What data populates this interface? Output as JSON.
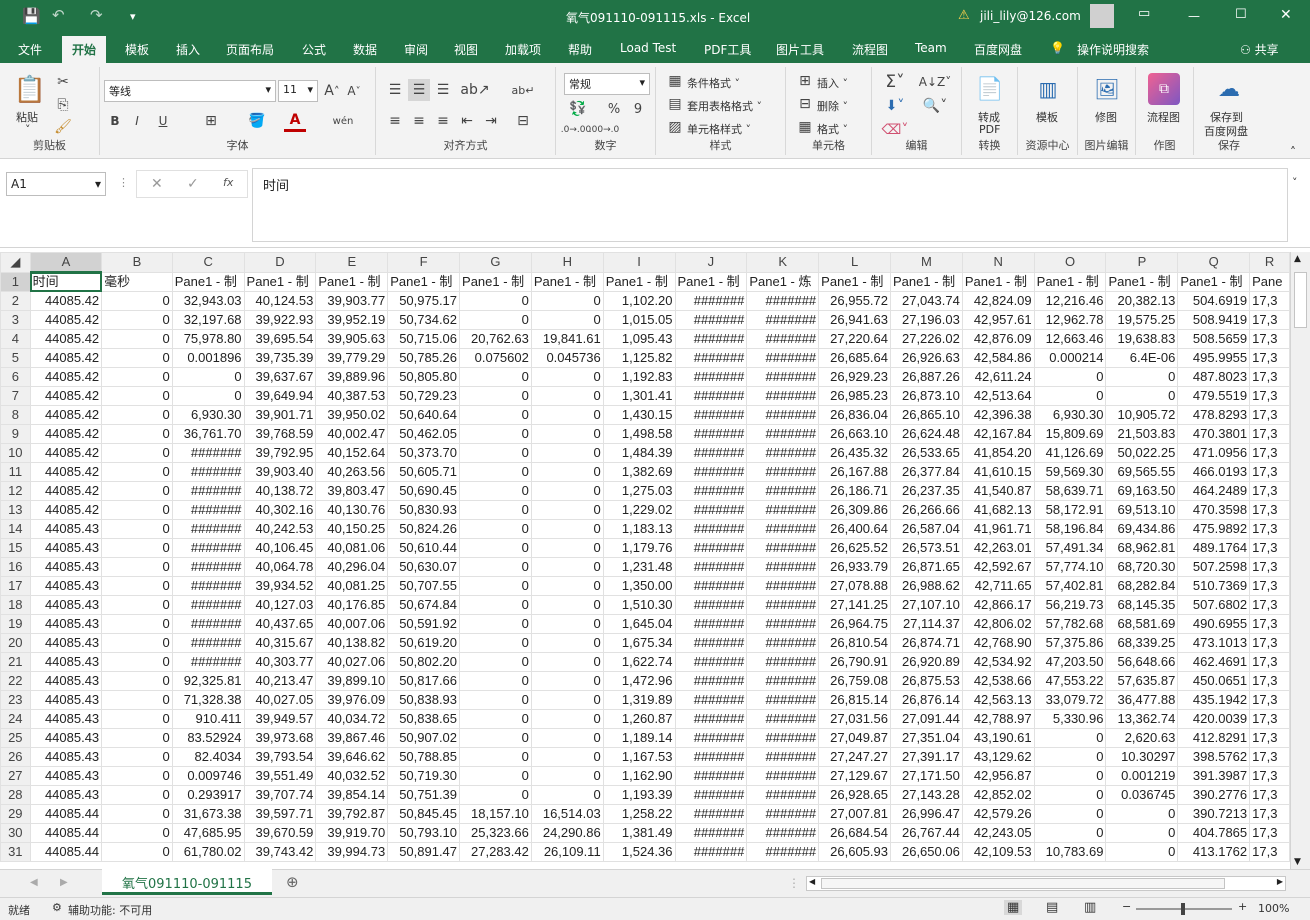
{
  "window": {
    "title": "氧气091110-091115.xls  -  Excel",
    "account": "jili_lily@126.com",
    "qat": [
      "save-icon",
      "undo-icon",
      "redo-icon",
      "customize-icon"
    ]
  },
  "tabs": [
    "文件",
    "开始",
    "模板",
    "插入",
    "页面布局",
    "公式",
    "数据",
    "审阅",
    "视图",
    "加载项",
    "帮助",
    "Load Test",
    "PDF工具",
    "图片工具",
    "流程图",
    "Team",
    "百度网盘"
  ],
  "active_tab": "开始",
  "tell_me": "操作说明搜索",
  "share": "共享",
  "ribbon": {
    "clipboard": {
      "paste": "粘贴",
      "label": "剪贴板"
    },
    "font": {
      "name": "等线",
      "size": "11",
      "bold": "B",
      "italic": "I",
      "underline": "U",
      "label": "字体",
      "wen": "wén"
    },
    "align": {
      "label": "对齐方式"
    },
    "number": {
      "format": "常规",
      "percent": "%",
      "comma": "9",
      "label": "数字"
    },
    "styles": {
      "cond": "条件格式 ˅",
      "table": "套用表格格式 ˅",
      "cell": "单元格样式 ˅",
      "label": "样式"
    },
    "cells": {
      "insert": "插入 ˅",
      "delete": "删除 ˅",
      "format": "格式 ˅",
      "label": "单元格"
    },
    "edit": {
      "label": "编辑"
    },
    "convert": {
      "btn1": "转成",
      "btn2": "PDF",
      "label": "转换"
    },
    "resource": {
      "btn": "模板",
      "label": "资源中心"
    },
    "picedit": {
      "btn": "修图",
      "label": "图片编辑"
    },
    "draw": {
      "btn": "流程图",
      "label": "作图"
    },
    "save": {
      "btn1": "保存到",
      "btn2": "百度网盘",
      "label": "保存"
    }
  },
  "formula_bar": {
    "name_box": "A1",
    "content": "时间",
    "fx": "fx"
  },
  "columns": [
    "A",
    "B",
    "C",
    "D",
    "E",
    "F",
    "G",
    "H",
    "I",
    "J",
    "K",
    "L",
    "M",
    "N",
    "O",
    "P",
    "Q",
    "R"
  ],
  "header_row": [
    "时间",
    "毫秒",
    "Pane1 - 制",
    "Pane1 - 制",
    "Pane1 - 制",
    "Pane1 - 制",
    "Pane1 - 制",
    "Pane1 - 制",
    "Pane1 - 制",
    "Pane1 - 制",
    "Pane1 - 炼",
    "Pane1 - 制",
    "Pane1 - 制",
    "Pane1 - 制",
    "Pane1 - 制",
    "Pane1 - 制",
    "Pane1 - 制",
    "Pane"
  ],
  "rows": [
    [
      "44085.42",
      "0",
      "32,943.03",
      "40,124.53",
      "39,903.77",
      "50,975.17",
      "0",
      "0",
      "1,102.20",
      "#######",
      "#######",
      "26,955.72",
      "27,043.74",
      "42,824.09",
      "12,216.46",
      "20,382.13",
      "504.6919",
      "17,3"
    ],
    [
      "44085.42",
      "0",
      "32,197.68",
      "39,922.93",
      "39,952.19",
      "50,734.62",
      "0",
      "0",
      "1,015.05",
      "#######",
      "#######",
      "26,941.63",
      "27,196.03",
      "42,957.61",
      "12,962.78",
      "19,575.25",
      "508.9419",
      "17,3"
    ],
    [
      "44085.42",
      "0",
      "75,978.80",
      "39,695.54",
      "39,905.63",
      "50,715.06",
      "20,762.63",
      "19,841.61",
      "1,095.43",
      "#######",
      "#######",
      "27,220.64",
      "27,226.02",
      "42,876.09",
      "12,663.46",
      "19,638.83",
      "508.5659",
      "17,3"
    ],
    [
      "44085.42",
      "0",
      "0.001896",
      "39,735.39",
      "39,779.29",
      "50,785.26",
      "0.075602",
      "0.045736",
      "1,125.82",
      "#######",
      "#######",
      "26,685.64",
      "26,926.63",
      "42,584.86",
      "0.000214",
      "6.4E-06",
      "495.9955",
      "17,3"
    ],
    [
      "44085.42",
      "0",
      "0",
      "39,637.67",
      "39,889.96",
      "50,805.80",
      "0",
      "0",
      "1,192.83",
      "#######",
      "#######",
      "26,929.23",
      "26,887.26",
      "42,611.24",
      "0",
      "0",
      "487.8023",
      "17,3"
    ],
    [
      "44085.42",
      "0",
      "0",
      "39,649.94",
      "40,387.53",
      "50,729.23",
      "0",
      "0",
      "1,301.41",
      "#######",
      "#######",
      "26,985.23",
      "26,873.10",
      "42,513.64",
      "0",
      "0",
      "479.5519",
      "17,3"
    ],
    [
      "44085.42",
      "0",
      "6,930.30",
      "39,901.71",
      "39,950.02",
      "50,640.64",
      "0",
      "0",
      "1,430.15",
      "#######",
      "#######",
      "26,836.04",
      "26,865.10",
      "42,396.38",
      "6,930.30",
      "10,905.72",
      "478.8293",
      "17,3"
    ],
    [
      "44085.42",
      "0",
      "36,761.70",
      "39,768.59",
      "40,002.47",
      "50,462.05",
      "0",
      "0",
      "1,498.58",
      "#######",
      "#######",
      "26,663.10",
      "26,624.48",
      "42,167.84",
      "15,809.69",
      "21,503.83",
      "470.3801",
      "17,3"
    ],
    [
      "44085.42",
      "0",
      "#######",
      "39,792.95",
      "40,152.64",
      "50,373.70",
      "0",
      "0",
      "1,484.39",
      "#######",
      "#######",
      "26,435.32",
      "26,533.65",
      "41,854.20",
      "41,126.69",
      "50,022.25",
      "471.0956",
      "17,3"
    ],
    [
      "44085.42",
      "0",
      "#######",
      "39,903.40",
      "40,263.56",
      "50,605.71",
      "0",
      "0",
      "1,382.69",
      "#######",
      "#######",
      "26,167.88",
      "26,377.84",
      "41,610.15",
      "59,569.30",
      "69,565.55",
      "466.0193",
      "17,3"
    ],
    [
      "44085.42",
      "0",
      "#######",
      "40,138.72",
      "39,803.47",
      "50,690.45",
      "0",
      "0",
      "1,275.03",
      "#######",
      "#######",
      "26,186.71",
      "26,237.35",
      "41,540.87",
      "58,639.71",
      "69,163.50",
      "464.2489",
      "17,3"
    ],
    [
      "44085.42",
      "0",
      "#######",
      "40,302.16",
      "40,130.76",
      "50,830.93",
      "0",
      "0",
      "1,229.02",
      "#######",
      "#######",
      "26,309.86",
      "26,266.66",
      "41,682.13",
      "58,172.91",
      "69,513.10",
      "470.3598",
      "17,3"
    ],
    [
      "44085.43",
      "0",
      "#######",
      "40,242.53",
      "40,150.25",
      "50,824.26",
      "0",
      "0",
      "1,183.13",
      "#######",
      "#######",
      "26,400.64",
      "26,587.04",
      "41,961.71",
      "58,196.84",
      "69,434.86",
      "475.9892",
      "17,3"
    ],
    [
      "44085.43",
      "0",
      "#######",
      "40,106.45",
      "40,081.06",
      "50,610.44",
      "0",
      "0",
      "1,179.76",
      "#######",
      "#######",
      "26,625.52",
      "26,573.51",
      "42,263.01",
      "57,491.34",
      "68,962.81",
      "489.1764",
      "17,3"
    ],
    [
      "44085.43",
      "0",
      "#######",
      "40,064.78",
      "40,296.04",
      "50,630.07",
      "0",
      "0",
      "1,231.48",
      "#######",
      "#######",
      "26,933.79",
      "26,871.65",
      "42,592.67",
      "57,774.10",
      "68,720.30",
      "507.2598",
      "17,3"
    ],
    [
      "44085.43",
      "0",
      "#######",
      "39,934.52",
      "40,081.25",
      "50,707.55",
      "0",
      "0",
      "1,350.00",
      "#######",
      "#######",
      "27,078.88",
      "26,988.62",
      "42,711.65",
      "57,402.81",
      "68,282.84",
      "510.7369",
      "17,3"
    ],
    [
      "44085.43",
      "0",
      "#######",
      "40,127.03",
      "40,176.85",
      "50,674.84",
      "0",
      "0",
      "1,510.30",
      "#######",
      "#######",
      "27,141.25",
      "27,107.10",
      "42,866.17",
      "56,219.73",
      "68,145.35",
      "507.6802",
      "17,3"
    ],
    [
      "44085.43",
      "0",
      "#######",
      "40,437.65",
      "40,007.06",
      "50,591.92",
      "0",
      "0",
      "1,645.04",
      "#######",
      "#######",
      "26,964.75",
      "27,114.37",
      "42,806.02",
      "57,782.68",
      "68,581.69",
      "490.6955",
      "17,3"
    ],
    [
      "44085.43",
      "0",
      "#######",
      "40,315.67",
      "40,138.82",
      "50,619.20",
      "0",
      "0",
      "1,675.34",
      "#######",
      "#######",
      "26,810.54",
      "26,874.71",
      "42,768.90",
      "57,375.86",
      "68,339.25",
      "473.1013",
      "17,3"
    ],
    [
      "44085.43",
      "0",
      "#######",
      "40,303.77",
      "40,027.06",
      "50,802.20",
      "0",
      "0",
      "1,622.74",
      "#######",
      "#######",
      "26,790.91",
      "26,920.89",
      "42,534.92",
      "47,203.50",
      "56,648.66",
      "462.4691",
      "17,3"
    ],
    [
      "44085.43",
      "0",
      "92,325.81",
      "40,213.47",
      "39,899.10",
      "50,817.66",
      "0",
      "0",
      "1,472.96",
      "#######",
      "#######",
      "26,759.08",
      "26,875.53",
      "42,538.66",
      "47,553.22",
      "57,635.87",
      "450.0651",
      "17,3"
    ],
    [
      "44085.43",
      "0",
      "71,328.38",
      "40,027.05",
      "39,976.09",
      "50,838.93",
      "0",
      "0",
      "1,319.89",
      "#######",
      "#######",
      "26,815.14",
      "26,876.14",
      "42,563.13",
      "33,079.72",
      "36,477.88",
      "435.1942",
      "17,3"
    ],
    [
      "44085.43",
      "0",
      "910.411",
      "39,949.57",
      "40,034.72",
      "50,838.65",
      "0",
      "0",
      "1,260.87",
      "#######",
      "#######",
      "27,031.56",
      "27,091.44",
      "42,788.97",
      "5,330.96",
      "13,362.74",
      "420.0039",
      "17,3"
    ],
    [
      "44085.43",
      "0",
      "83.52924",
      "39,973.68",
      "39,867.46",
      "50,907.02",
      "0",
      "0",
      "1,189.14",
      "#######",
      "#######",
      "27,049.87",
      "27,351.04",
      "43,190.61",
      "0",
      "2,620.63",
      "412.8291",
      "17,3"
    ],
    [
      "44085.43",
      "0",
      "82.4034",
      "39,793.54",
      "39,646.62",
      "50,788.85",
      "0",
      "0",
      "1,167.53",
      "#######",
      "#######",
      "27,247.27",
      "27,391.17",
      "43,129.62",
      "0",
      "10.30297",
      "398.5762",
      "17,3"
    ],
    [
      "44085.43",
      "0",
      "0.009746",
      "39,551.49",
      "40,032.52",
      "50,719.30",
      "0",
      "0",
      "1,162.90",
      "#######",
      "#######",
      "27,129.67",
      "27,171.50",
      "42,956.87",
      "0",
      "0.001219",
      "391.3987",
      "17,3"
    ],
    [
      "44085.43",
      "0",
      "0.293917",
      "39,707.74",
      "39,854.14",
      "50,751.39",
      "0",
      "0",
      "1,193.39",
      "#######",
      "#######",
      "26,928.65",
      "27,143.28",
      "42,852.02",
      "0",
      "0.036745",
      "390.2776",
      "17,3"
    ],
    [
      "44085.44",
      "0",
      "31,673.38",
      "39,597.71",
      "39,792.87",
      "50,845.45",
      "18,157.10",
      "16,514.03",
      "1,258.22",
      "#######",
      "#######",
      "27,007.81",
      "26,996.47",
      "42,579.26",
      "0",
      "0",
      "390.7213",
      "17,3"
    ],
    [
      "44085.44",
      "0",
      "47,685.95",
      "39,670.59",
      "39,919.70",
      "50,793.10",
      "25,323.66",
      "24,290.86",
      "1,381.49",
      "#######",
      "#######",
      "26,684.54",
      "26,767.44",
      "42,243.05",
      "0",
      "0",
      "404.7865",
      "17,3"
    ],
    [
      "44085.44",
      "0",
      "61,780.02",
      "39,743.42",
      "39,994.73",
      "50,891.47",
      "27,283.42",
      "26,109.11",
      "1,524.36",
      "#######",
      "#######",
      "26,605.93",
      "26,650.06",
      "42,109.53",
      "10,783.69",
      "0",
      "413.1762",
      "17,3"
    ]
  ],
  "sheet_tab": "氧气091110-091115",
  "status": {
    "ready": "就绪",
    "accessibility": "辅助功能: 不可用",
    "zoom": "100%"
  }
}
